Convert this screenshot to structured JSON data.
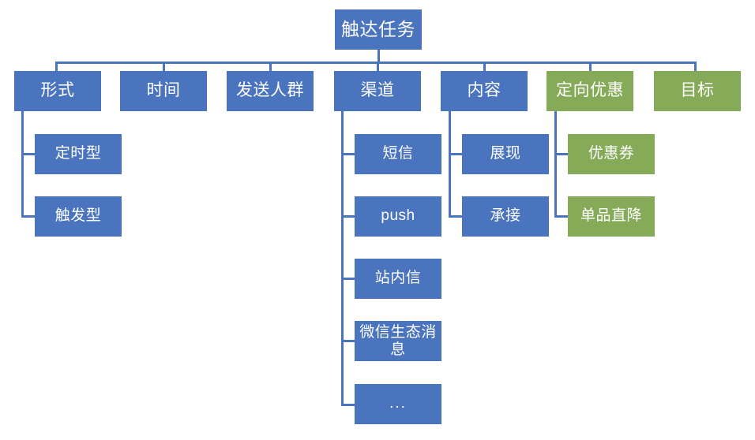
{
  "diagram": {
    "title": "触达任务",
    "colors": {
      "blue": "#4a74be",
      "green": "#85ab59",
      "line": "#4a74be",
      "text": "#ffffff",
      "background": "#ffffff"
    },
    "root": {
      "label": "触达任务"
    },
    "level2": [
      {
        "label": "形式",
        "color": "blue"
      },
      {
        "label": "时间",
        "color": "blue"
      },
      {
        "label": "发送人群",
        "color": "blue"
      },
      {
        "label": "渠道",
        "color": "blue"
      },
      {
        "label": "内容",
        "color": "blue"
      },
      {
        "label": "定向优惠",
        "color": "green"
      },
      {
        "label": "目标",
        "color": "green"
      }
    ],
    "children_form": [
      {
        "label": "定时型",
        "color": "blue"
      },
      {
        "label": "触发型",
        "color": "blue"
      }
    ],
    "children_channel": [
      {
        "label": "短信",
        "color": "blue"
      },
      {
        "label": "push",
        "color": "blue"
      },
      {
        "label": "站内信",
        "color": "blue"
      },
      {
        "label": "微信生态消息",
        "color": "blue"
      },
      {
        "label": "...",
        "color": "blue"
      }
    ],
    "children_content": [
      {
        "label": "展现",
        "color": "blue"
      },
      {
        "label": "承接",
        "color": "blue"
      }
    ],
    "children_promo": [
      {
        "label": "优惠券",
        "color": "green"
      },
      {
        "label": "单品直降",
        "color": "green"
      }
    ]
  }
}
